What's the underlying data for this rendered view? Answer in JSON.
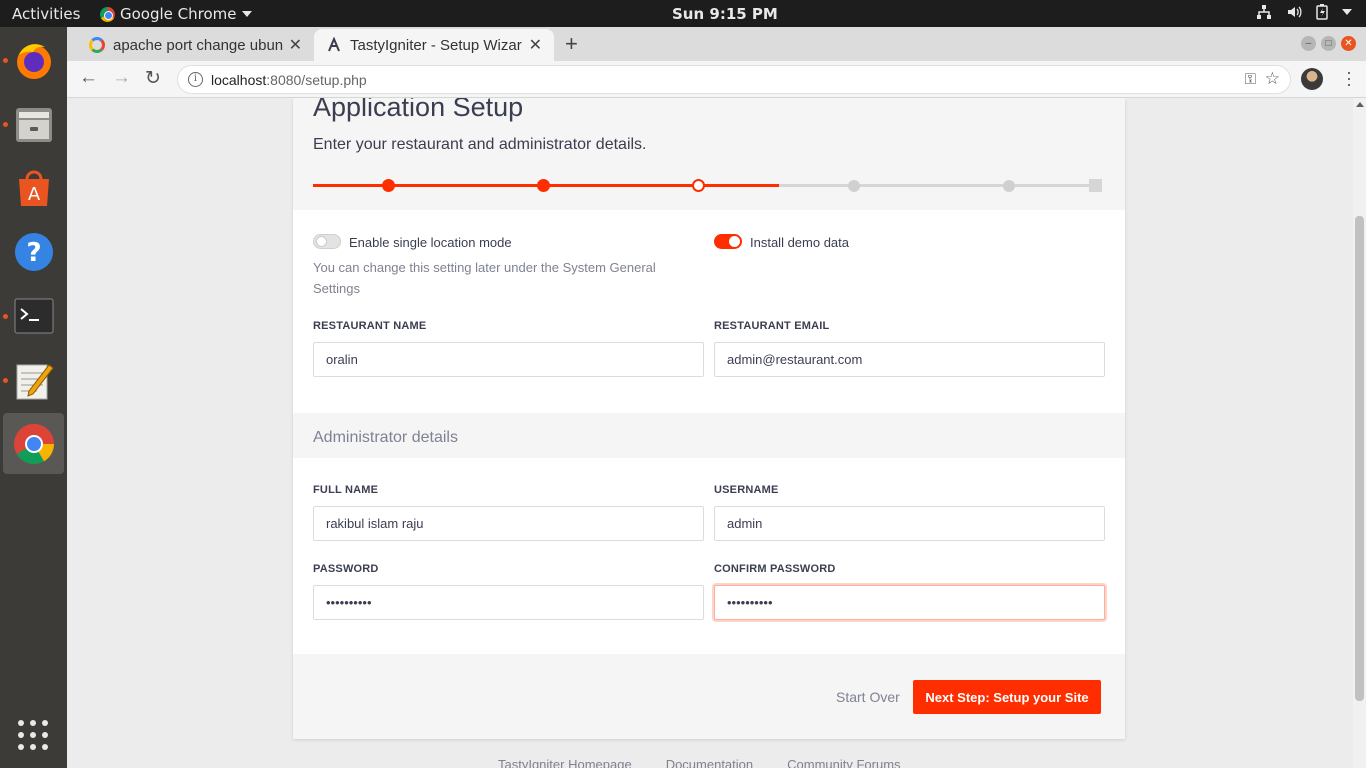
{
  "topbar": {
    "activities": "Activities",
    "app_name": "Google Chrome",
    "clock": "Sun  9:15 PM"
  },
  "dock": {
    "items": [
      "firefox",
      "files",
      "software",
      "help",
      "terminal",
      "text-editor",
      "chrome"
    ],
    "active": "chrome"
  },
  "browser": {
    "tabs": [
      {
        "title": "apache port change ubun",
        "active": false
      },
      {
        "title": "TastyIgniter - Setup Wizar",
        "active": true
      }
    ],
    "url_host": "localhost",
    "url_rest": ":8080/setup.php"
  },
  "setup": {
    "title": "Application Setup",
    "subtitle": "Enter your restaurant and administrator details.",
    "progress": {
      "steps_total": 6,
      "steps_completed": 2,
      "current_step": 3
    },
    "single_location": {
      "label": "Enable single location mode",
      "enabled": false,
      "help": "You can change this setting later under the System General Settings"
    },
    "demo_data": {
      "label": "Install demo data",
      "enabled": true
    },
    "restaurant_name": {
      "label": "RESTAURANT NAME",
      "value": "oralin"
    },
    "restaurant_email": {
      "label": "RESTAURANT EMAIL",
      "value": "admin@restaurant.com"
    },
    "admin_section": "Administrator details",
    "full_name": {
      "label": "FULL NAME",
      "value": "rakibul islam raju"
    },
    "username": {
      "label": "USERNAME",
      "value": "admin"
    },
    "password": {
      "label": "PASSWORD",
      "value": "••••••••••"
    },
    "confirm_password": {
      "label": "CONFIRM PASSWORD",
      "value": "••••••••••"
    },
    "start_over": "Start Over",
    "next_button": "Next Step: Setup your Site"
  },
  "footer_links": [
    "TastyIgniter Homepage",
    "Documentation",
    "Community Forums"
  ],
  "colors": {
    "accent": "#ff2e00",
    "ubuntu_orange": "#e95420",
    "dock": "#3c3b37"
  }
}
